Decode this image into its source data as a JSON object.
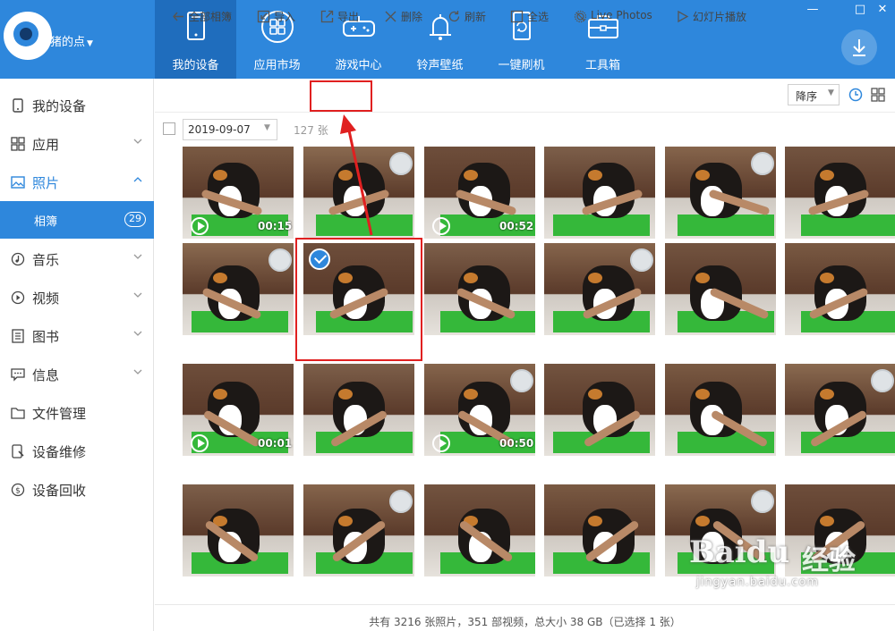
{
  "app": {
    "title": "猪的点"
  },
  "nav": [
    {
      "label": "我的设备",
      "icon": "tablet-icon"
    },
    {
      "label": "应用市场",
      "icon": "app-grid-icon"
    },
    {
      "label": "游戏中心",
      "icon": "gamepad-icon"
    },
    {
      "label": "铃声壁纸",
      "icon": "bell-icon"
    },
    {
      "label": "一键刷机",
      "icon": "phone-refresh-icon"
    },
    {
      "label": "工具箱",
      "icon": "toolbox-icon"
    }
  ],
  "sidebar": {
    "items": [
      {
        "label": "我的设备",
        "icon": "phone-icon"
      },
      {
        "label": "应用",
        "icon": "apps-icon"
      },
      {
        "label": "照片",
        "icon": "image-icon"
      },
      {
        "label": "相簿",
        "badge": "29"
      },
      {
        "label": "音乐",
        "icon": "music-icon"
      },
      {
        "label": "视频",
        "icon": "video-icon"
      },
      {
        "label": "图书",
        "icon": "book-icon"
      },
      {
        "label": "信息",
        "icon": "message-icon"
      },
      {
        "label": "文件管理",
        "icon": "folder-icon"
      },
      {
        "label": "设备维修",
        "icon": "repair-icon"
      },
      {
        "label": "设备回收",
        "icon": "recycle-icon"
      }
    ]
  },
  "toolbar": {
    "back": "全部相簿",
    "import": "导入",
    "export": "导出",
    "delete": "删除",
    "refresh": "刷新",
    "select_all": "全选",
    "live_photos": "Live Photos",
    "slideshow": "幻灯片播放",
    "sort": "降序"
  },
  "filter": {
    "date": "2019-09-07",
    "count": "127 张"
  },
  "media": {
    "durations": [
      "00:15",
      "00:52",
      "00:01",
      "00:50"
    ],
    "selected_count": 1
  },
  "status": "共有 3216 张照片，351 部视频，总大小 38 GB（已选择 1 张）",
  "watermark": {
    "brand": "Baidu",
    "cn": "经验",
    "url": "jingyan.baidu.com"
  },
  "colors": {
    "accent": "#2e87dc",
    "nav_active": "#1f6dbd",
    "highlight": "#e02020",
    "mat": "#35b83a"
  }
}
